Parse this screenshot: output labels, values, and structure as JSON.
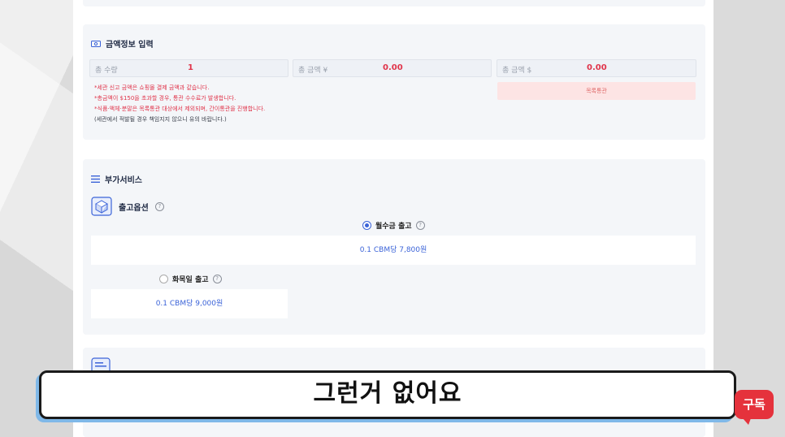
{
  "amount_section": {
    "title": "금액정보 입력",
    "fields": [
      {
        "label": "총 수량",
        "value": "1"
      },
      {
        "label": "총 금액 ¥",
        "value": "0.00"
      },
      {
        "label": "총 금액 $",
        "value": "0.00"
      }
    ],
    "notes": [
      "*세관 신고 금액은 쇼핑몰 결제 금액과 같습니다.",
      "*총금액이 $150을 초과할 경우, 통관 수수료가 발생합니다.",
      "*식품·액체·분말은 목록통관 대상에서 제외되며, 간이통관을 진행합니다.",
      "(세관에서 적발될 경우 책임지지 않으니 유의 바랍니다.)"
    ],
    "customs_button": "목록통관"
  },
  "extra_services": {
    "title": "부가서비스",
    "shipping_option_title": "출고옵션",
    "options": [
      {
        "label": "월수금 출고",
        "price": "0.1 CBM당 7,800원",
        "selected": true
      },
      {
        "label": "화목일 출고",
        "price": "0.1 CBM당 9,000원",
        "selected": false
      }
    ]
  },
  "overlay": {
    "subtitle": "그런거 없어요",
    "subscribe": "구독"
  },
  "colors": {
    "accent": "#3b63d8",
    "value_red": "#e0344a",
    "subscribe_red": "#e5323c"
  }
}
